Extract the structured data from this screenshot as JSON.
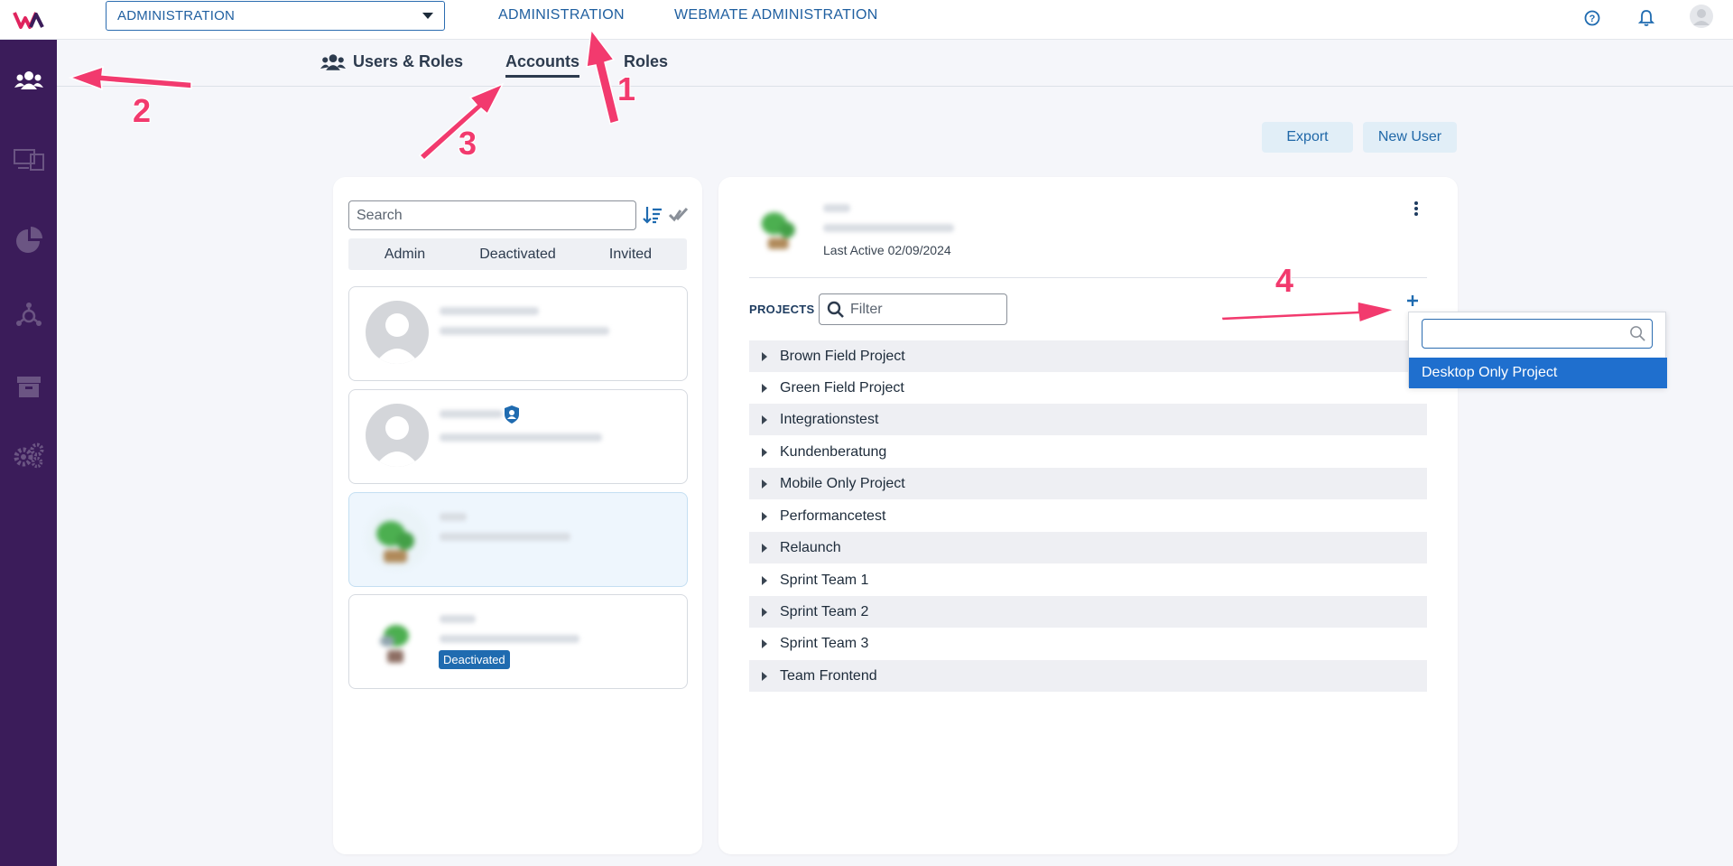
{
  "topbar": {
    "context_select": "ADMINISTRATION",
    "nav": [
      "ADMINISTRATION",
      "WEBMATE ADMINISTRATION"
    ]
  },
  "sidebar": {
    "items": [
      "users-icon",
      "devices-icon",
      "analytics-icon",
      "integrations-icon",
      "archive-icon",
      "settings-icon"
    ]
  },
  "subtabs": {
    "users_roles": "Users & Roles",
    "accounts": "Accounts",
    "roles": "Roles"
  },
  "actions": {
    "export": "Export",
    "new_user": "New User"
  },
  "user_list": {
    "search_placeholder": "Search",
    "filters": [
      "Admin",
      "Deactivated",
      "Invited"
    ],
    "deactivated_badge": "Deactivated"
  },
  "detail": {
    "last_active": "Last Active 02/09/2024",
    "projects_label": "PROJECTS",
    "filter_placeholder": "Filter",
    "projects": [
      "Brown Field Project",
      "Green Field Project",
      "Integrationstest",
      "Kundenberatung",
      "Mobile Only Project",
      "Performancetest",
      "Relaunch",
      "Sprint Team 1",
      "Sprint Team 2",
      "Sprint Team 3",
      "Team Frontend"
    ]
  },
  "add_project_dropdown": {
    "option": "Desktop Only Project"
  },
  "annotations": [
    "1",
    "2",
    "3",
    "4"
  ],
  "colors": {
    "sidebar": "#3b1c5a",
    "accent": "#1f6bb0",
    "annotation": "#f23a6e"
  }
}
